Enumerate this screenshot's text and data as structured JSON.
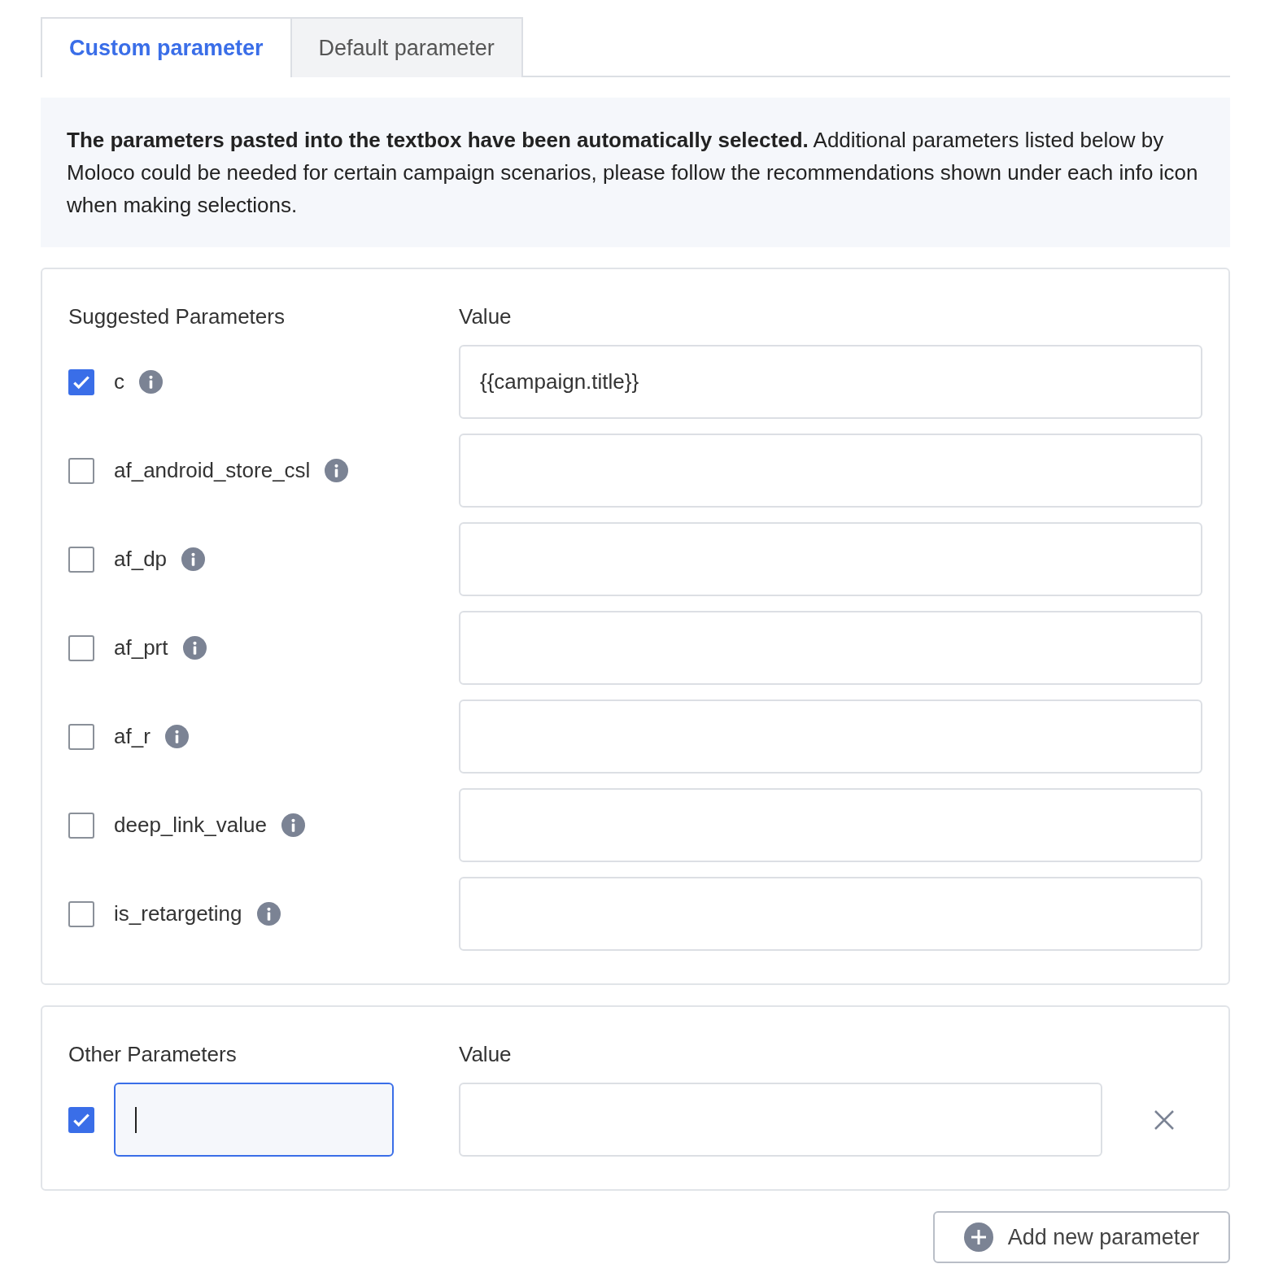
{
  "tabs": [
    {
      "label": "Custom parameter",
      "selected": true
    },
    {
      "label": "Default parameter",
      "selected": false
    }
  ],
  "notice": "**The parameters pasted into the textbox have been automatically selected.** Additional parameters listed below by Moloco could be needed for certain campaign scenarios, please follow the recommendations shown under each info icon when making selections.",
  "suggested": {
    "name_header": "Suggested Parameters",
    "value_header": "Value",
    "rows": [
      {
        "name": "c",
        "checked": true,
        "value": "{{campaign.title}}"
      },
      {
        "name": "af_android_store_csl",
        "checked": false
      },
      {
        "name": "af_dp",
        "checked": false
      },
      {
        "name": "af_prt",
        "checked": false
      },
      {
        "name": "af_r",
        "checked": false
      },
      {
        "name": "deep_link_value",
        "checked": false
      },
      {
        "name": "is_retargeting",
        "checked": false
      }
    ]
  },
  "other": {
    "name_header": "Other Parameters",
    "value_header": "Value",
    "rows": [
      {
        "checked": true,
        "name_focused": true
      }
    ]
  },
  "add_button": "Add new parameter"
}
